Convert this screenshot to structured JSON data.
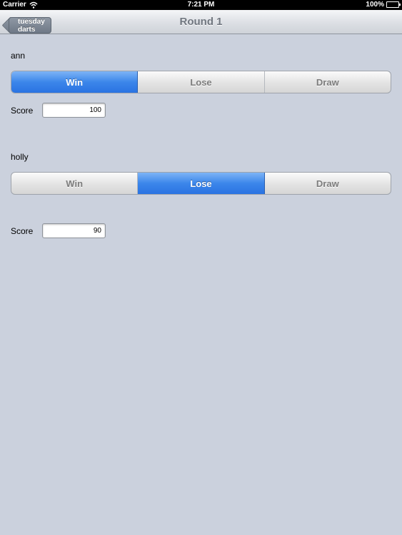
{
  "status_bar": {
    "carrier": "Carrier",
    "time": "7:21 PM",
    "battery": "100%",
    "wifi_icon": "wifi-icon",
    "battery_icon": "battery-icon"
  },
  "nav": {
    "back_label": "tuesday darts",
    "title": "Round 1"
  },
  "players": [
    {
      "name": "ann",
      "options": [
        "Win",
        "Lose",
        "Draw"
      ],
      "selected": "Win",
      "score_label": "Score",
      "score": "100"
    },
    {
      "name": "holly",
      "options": [
        "Win",
        "Lose",
        "Draw"
      ],
      "selected": "Lose",
      "score_label": "Score",
      "score": "90"
    }
  ],
  "colors": {
    "background": "#cbd1dd",
    "selected_segment": "#3c86ea"
  }
}
